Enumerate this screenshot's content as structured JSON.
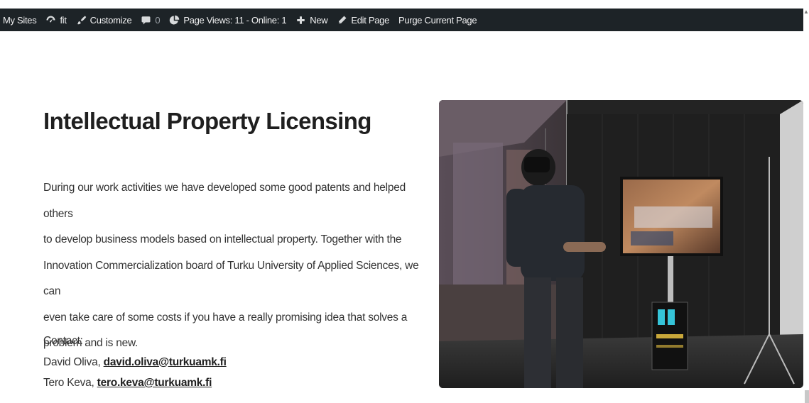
{
  "adminbar": {
    "my_sites": "My Sites",
    "site_name": "fit",
    "customize": "Customize",
    "comments_count": "0",
    "page_views": "Page Views: 11 - Online: 1",
    "new": "New",
    "edit_page": "Edit Page",
    "purge": "Purge Current Page"
  },
  "content": {
    "title": "Intellectual Property Licensing",
    "paragraph_lines": [
      "During our work activities we have developed some good patents and helped others",
      "to develop business models based on intellectual property. Together with the",
      "Innovation Commercialization board of Turku University of Applied Sciences, we can",
      "even take care of some costs if you have a really promising idea that solves a",
      "problem and is new."
    ],
    "contact_heading": "Contact:",
    "contacts": [
      {
        "name": "David Oliva, ",
        "email": "david.oliva@turkuamk.fi"
      },
      {
        "name": "Tero Keva, ",
        "email": "tero.keva@turkuamk.fi"
      }
    ]
  },
  "photo": {
    "icon": "vr-demo-photo"
  }
}
